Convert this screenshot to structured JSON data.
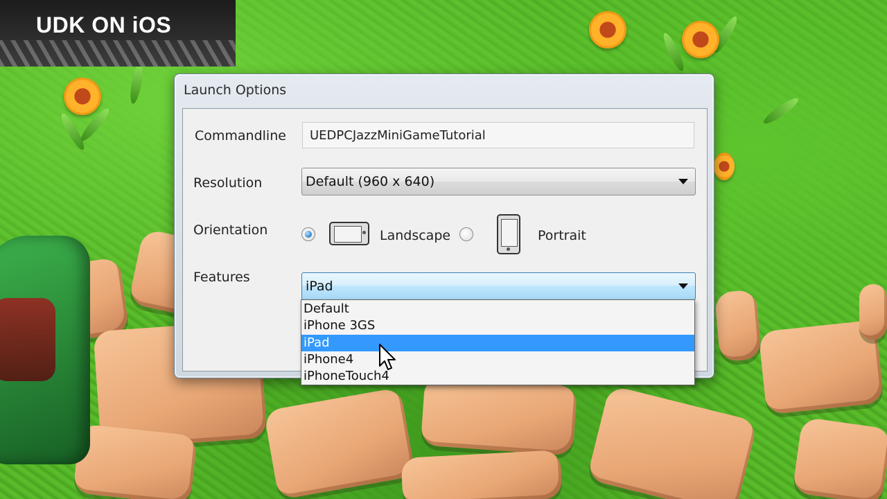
{
  "banner": {
    "title": "UDK ON iOS"
  },
  "dialog": {
    "title": "Launch Options",
    "commandline": {
      "label": "Commandline",
      "value": "UEDPCJazzMiniGameTutorial"
    },
    "resolution": {
      "label": "Resolution",
      "selected": "Default (960 x 640)"
    },
    "orientation": {
      "label": "Orientation",
      "options": [
        {
          "label": "Landscape",
          "checked": true,
          "icon": "landscape-device-icon"
        },
        {
          "label": "Portrait",
          "checked": false,
          "icon": "portrait-device-icon"
        }
      ]
    },
    "features": {
      "label": "Features",
      "selected": "iPad",
      "options": [
        "Default",
        "iPhone 3GS",
        "iPad",
        "iPhone4",
        "iPhoneTouch4"
      ],
      "highlighted_index": 2
    }
  },
  "colors": {
    "selection_highlight": "#3399ff",
    "combo_focus_border": "#3c7fb1",
    "grass": "#4ea823",
    "stone": "#e9a776"
  },
  "icons": [
    "landscape-device-icon",
    "portrait-device-icon",
    "dropdown-arrow-icon",
    "mouse-cursor-icon"
  ]
}
